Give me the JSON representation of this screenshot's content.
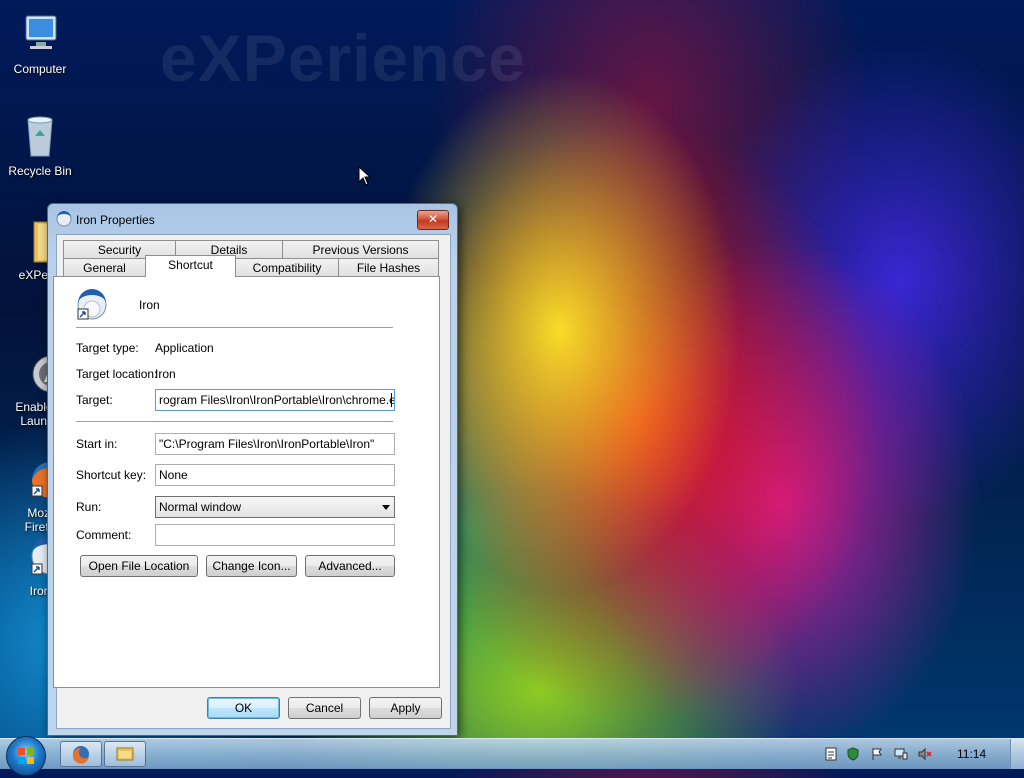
{
  "desktop": {
    "watermark": "eXPerience",
    "icons": [
      {
        "label": "Computer"
      },
      {
        "label": "Recycle Bin"
      },
      {
        "label": "eXPerie"
      },
      {
        "label": "Enable C\nLaunch"
      },
      {
        "label": "Mozi\nFirefo"
      },
      {
        "label": "Iron"
      }
    ]
  },
  "dialog": {
    "title": "Iron Properties",
    "close_label": "✕",
    "tabs_row1": [
      "Security",
      "Details",
      "Previous Versions"
    ],
    "tabs_row2": [
      "General",
      "Shortcut",
      "Compatibility",
      "File Hashes"
    ],
    "active_tab": "Shortcut",
    "app_name": "Iron",
    "target_type_label": "Target type:",
    "target_type_value": "Application",
    "target_location_label": "Target location:",
    "target_location_value": "Iron",
    "target_label": "Target:",
    "target_value": "rogram Files\\Iron\\IronPortable\\Iron\\chrome.exe\"",
    "start_in_label": "Start in:",
    "start_in_value": "\"C:\\Program Files\\Iron\\IronPortable\\Iron\"",
    "shortcut_key_label": "Shortcut key:",
    "shortcut_key_value": "None",
    "run_label": "Run:",
    "run_value": "Normal window",
    "comment_label": "Comment:",
    "comment_value": "",
    "open_file_location": "Open File Location",
    "change_icon": "Change Icon...",
    "advanced": "Advanced...",
    "ok": "OK",
    "cancel": "Cancel",
    "apply": "Apply"
  },
  "taskbar": {
    "clock": "11:14"
  },
  "colors": {
    "accent": "#3c7fb1",
    "titlebar": "#b9d1ea",
    "close": "#c13a1f"
  }
}
